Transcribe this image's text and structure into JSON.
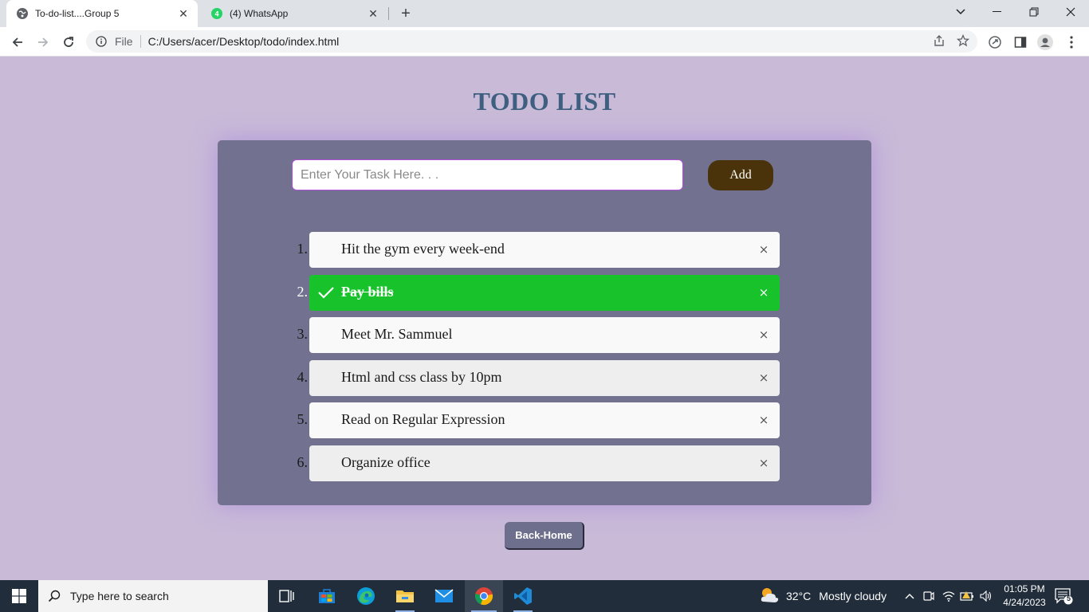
{
  "browser": {
    "tabs": [
      {
        "title": "To-do-list....Group 5",
        "active": true
      },
      {
        "title": "(4) WhatsApp",
        "active": false
      }
    ],
    "address": {
      "scheme_label": "File",
      "url": "C:/Users/acer/Desktop/todo/index.html"
    }
  },
  "page": {
    "title": "TODO LIST",
    "input": {
      "value": "",
      "placeholder": "Enter Your Task Here. . ."
    },
    "add_label": "Add",
    "tasks": [
      {
        "number": "1.",
        "text": "Hit the gym every week-end",
        "done": false
      },
      {
        "number": "2.",
        "text": "Pay bills",
        "done": true
      },
      {
        "number": "3.",
        "text": "Meet Mr. Sammuel",
        "done": false
      },
      {
        "number": "4.",
        "text": "Html and css class by 10pm",
        "done": false
      },
      {
        "number": "5.",
        "text": "Read on Regular Expression",
        "done": false
      },
      {
        "number": "6.",
        "text": "Organize office",
        "done": false
      }
    ],
    "close_glyph": "×",
    "back_label": "Back-Home"
  },
  "taskbar": {
    "search_placeholder": "Type here to search",
    "weather": {
      "temp": "32°C",
      "desc": "Mostly cloudy"
    },
    "clock": {
      "time": "01:05 PM",
      "date": "4/24/2023"
    },
    "notification_count": "5"
  },
  "colors": {
    "page_bg": "#c9bad8",
    "card_bg": "#72718f",
    "title": "#3e5f80",
    "done_green": "#18c22b",
    "add_button": "#4a330a"
  }
}
